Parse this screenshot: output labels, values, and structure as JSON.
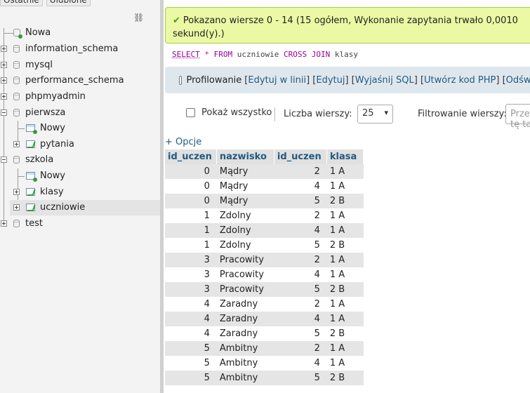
{
  "navigation": {
    "top_buttons": [
      "Ostatnie",
      "Ulubione"
    ],
    "link_icon": "chain-link-icon",
    "tree": [
      {
        "label": "Nowa",
        "kind": "new-database"
      },
      {
        "label": "information_schema",
        "kind": "database"
      },
      {
        "label": "mysql",
        "kind": "database"
      },
      {
        "label": "performance_schema",
        "kind": "database"
      },
      {
        "label": "phpmyadmin",
        "kind": "database"
      },
      {
        "label": "pierwsza",
        "kind": "database"
      },
      {
        "label": "Nowy",
        "kind": "new-table"
      },
      {
        "label": "pytania",
        "kind": "table"
      },
      {
        "label": "szkola",
        "kind": "database"
      },
      {
        "label": "Nowy",
        "kind": "new-table"
      },
      {
        "label": "klasy",
        "kind": "table"
      },
      {
        "label": "uczniowie",
        "kind": "table",
        "selected": true
      },
      {
        "label": "test",
        "kind": "database"
      }
    ]
  },
  "message": {
    "text_line1": "Pokazano wiersze 0 - 14 (15 ogółem, Wykonanie zapytania trwało 0,0010",
    "text_line2": "sekund(y).)",
    "icon": "check-icon"
  },
  "query": {
    "select": "SELECT",
    "star": "*",
    "from": "FROM",
    "table1": "uczniowie",
    "cross_join": "CROSS JOIN",
    "table2": "klasy"
  },
  "toolbar": {
    "profiling": "Profilowanie",
    "open_bracket": "[",
    "inline_edit": "Edytuj w linii",
    "sep1": "] [",
    "edit": "Edytuj",
    "sep2": "] [",
    "explain": "Wyjaśnij SQL",
    "sep3": "] [",
    "php_code": "Utwórz kod PHP",
    "sep4": "] [",
    "refresh": "Odśwież"
  },
  "controls": {
    "show_all": "Pokaż wszystko",
    "rows_label": "Liczba wierszy:",
    "rows_value": "25",
    "filter_label": "Filtrowanie wierszy:",
    "filter_placeholder": "Przeszukaj tę tabelę"
  },
  "options_link": "+ Opcje",
  "results": {
    "columns": [
      "id_uczen",
      "nazwisko",
      "id_uczen",
      "klasa"
    ],
    "rows": [
      [
        "0",
        "Mądry",
        "2",
        "1 A"
      ],
      [
        "0",
        "Mądry",
        "4",
        "1 A"
      ],
      [
        "0",
        "Mądry",
        "5",
        "2 B"
      ],
      [
        "1",
        "Zdolny",
        "2",
        "1 A"
      ],
      [
        "1",
        "Zdolny",
        "4",
        "1 A"
      ],
      [
        "1",
        "Zdolny",
        "5",
        "2 B"
      ],
      [
        "3",
        "Pracowity",
        "2",
        "1 A"
      ],
      [
        "3",
        "Pracowity",
        "4",
        "1 A"
      ],
      [
        "3",
        "Pracowity",
        "5",
        "2 B"
      ],
      [
        "4",
        "Zaradny",
        "2",
        "1 A"
      ],
      [
        "4",
        "Zaradny",
        "4",
        "1 A"
      ],
      [
        "4",
        "Zaradny",
        "5",
        "2 B"
      ],
      [
        "5",
        "Ambitny",
        "2",
        "1 A"
      ],
      [
        "5",
        "Ambitny",
        "4",
        "1 A"
      ],
      [
        "5",
        "Ambitny",
        "5",
        "2 B"
      ]
    ]
  },
  "colors": {
    "link": "#235a81",
    "success_bg": "#ebf8a4",
    "success_border": "#a2d246",
    "header_bg": "#e0e0e0",
    "stripe": "#e5e5e5"
  }
}
